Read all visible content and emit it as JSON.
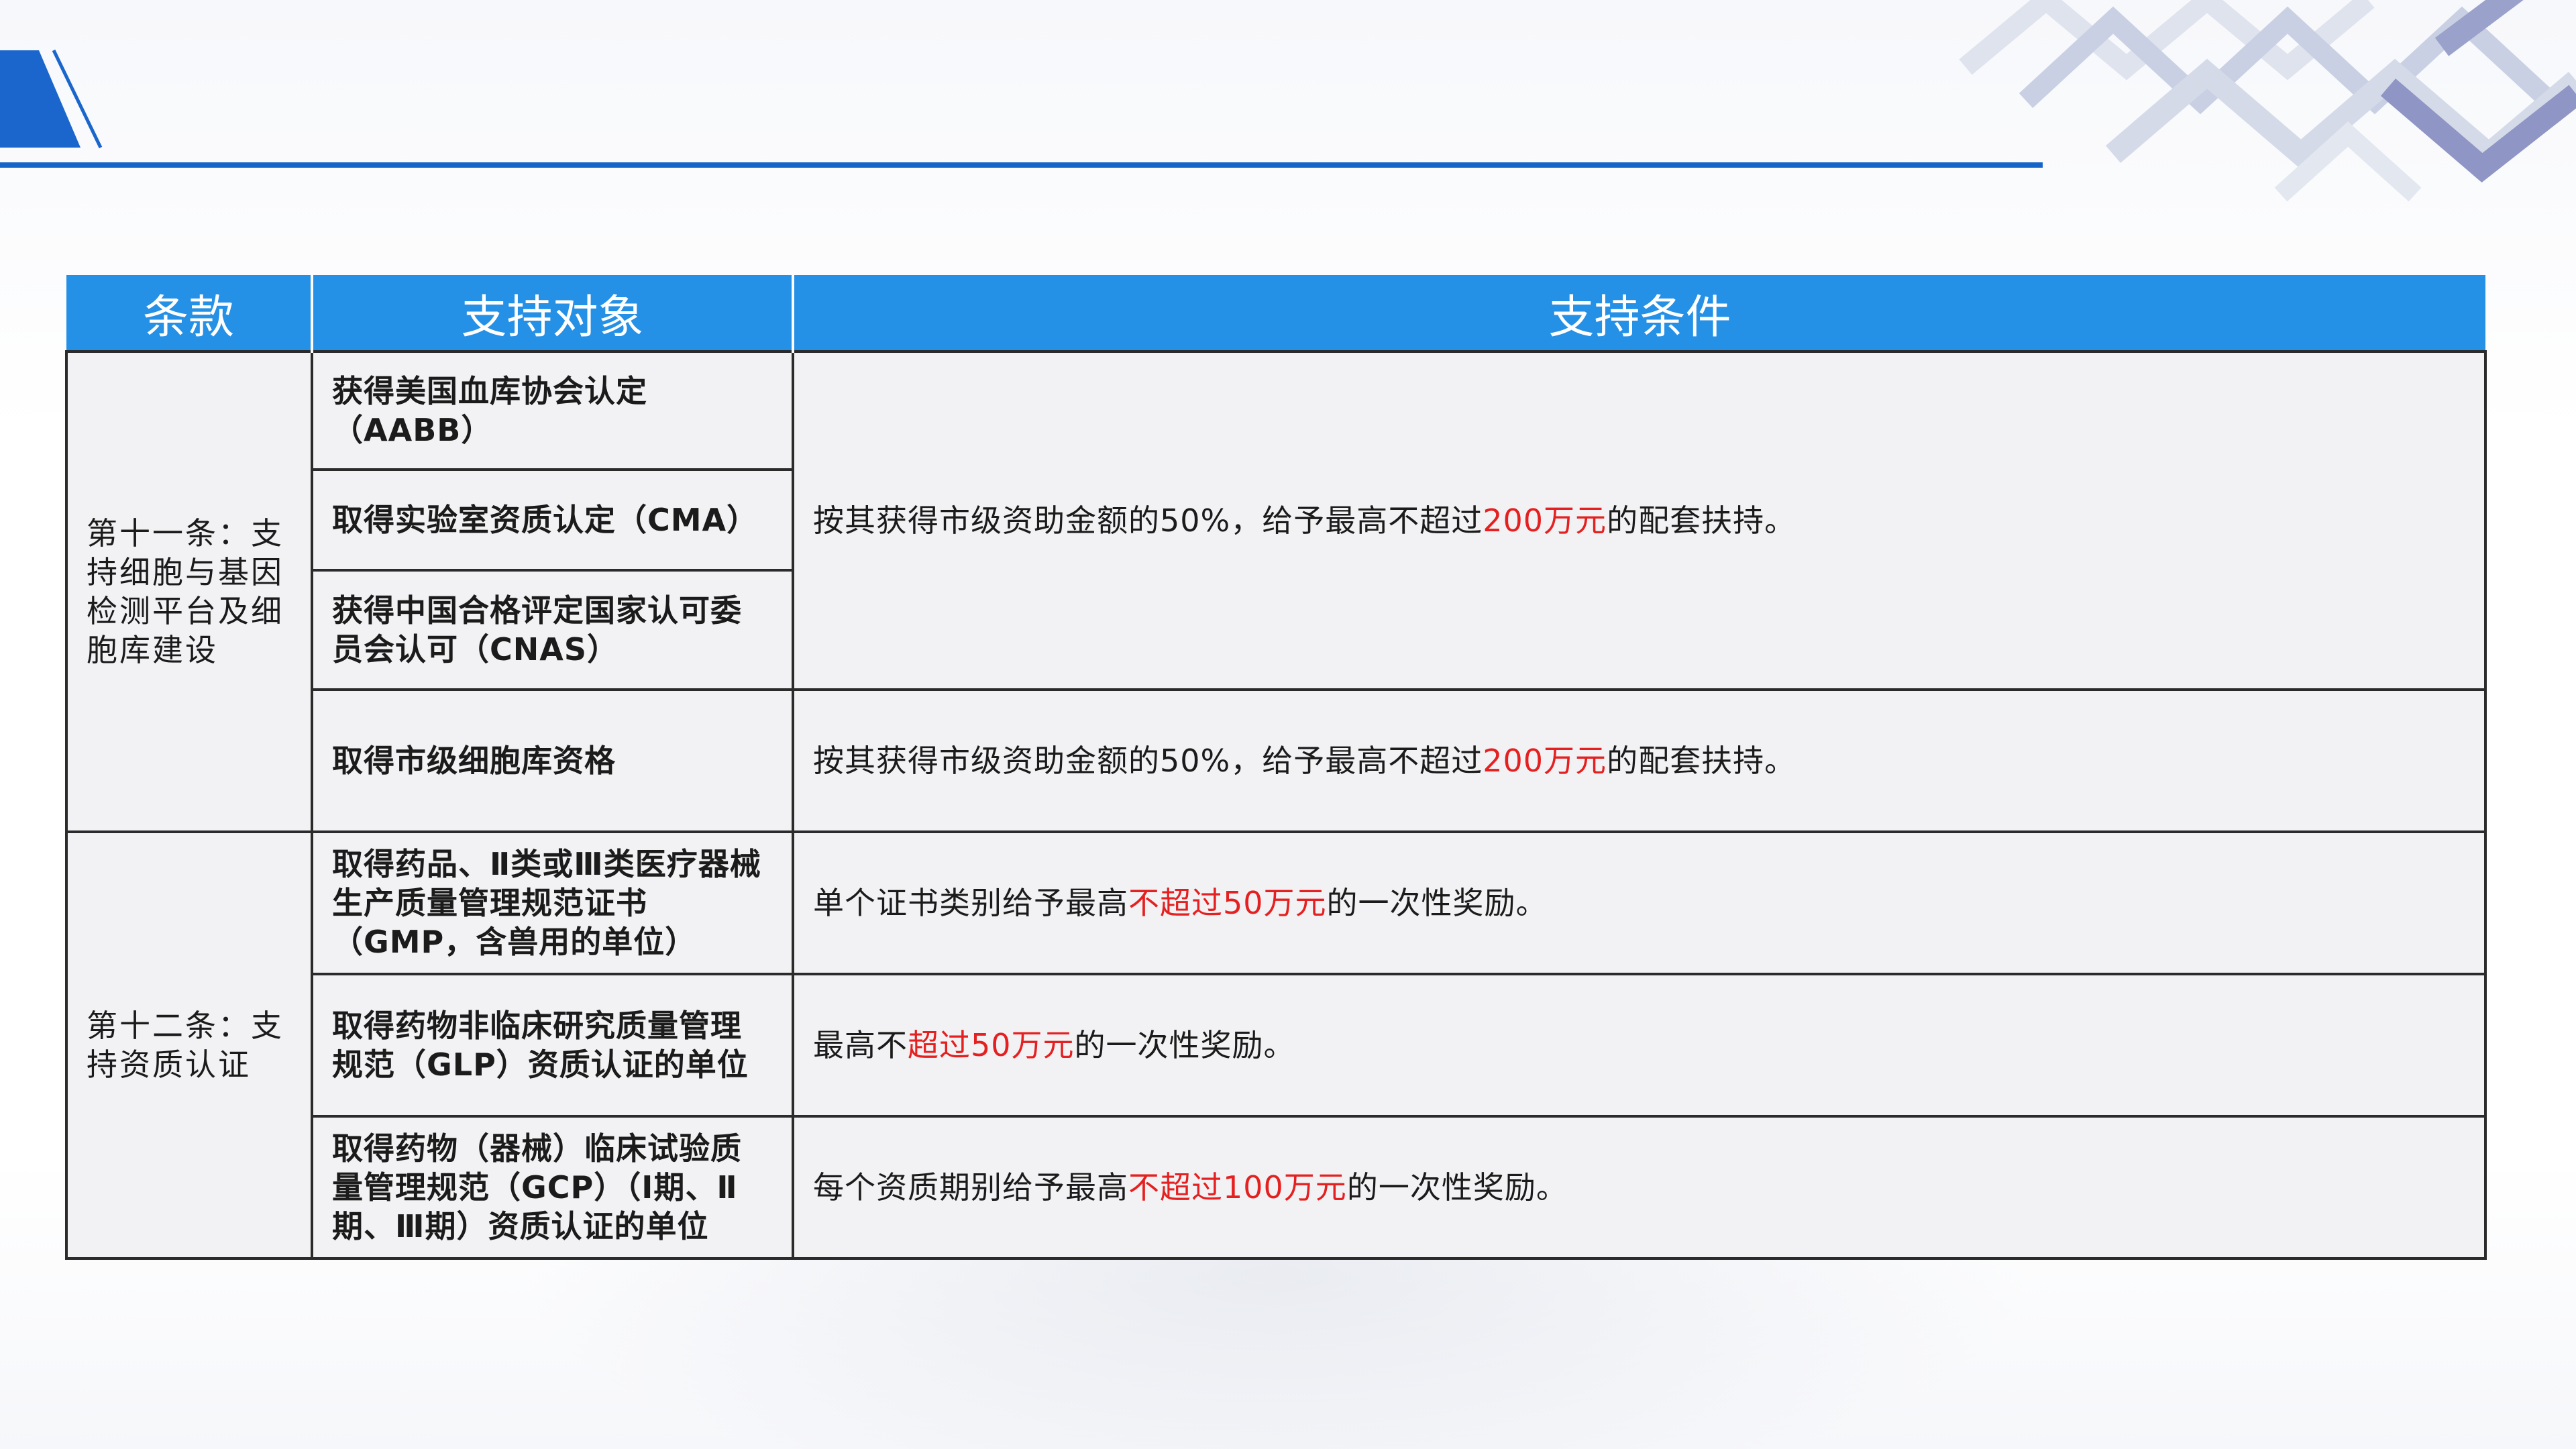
{
  "colors": {
    "accent": "#1565c8",
    "header_bg": "#2490e6",
    "target_text": "#2a78d0",
    "highlight": "#e52020",
    "cell_bg": "#f2f2f4"
  },
  "table": {
    "headers": [
      "条款",
      "支持对象",
      "支持条件"
    ],
    "clause_11": "第十一条：支持细胞与基因检测平台及细胞库建设",
    "clause_12": "第十二条：支持资质认证",
    "targets": [
      "获得美国血库协会认定（AABB）",
      "取得实验室资质认定（CMA）",
      "获得中国合格评定国家认可委员会认可（CNAS）",
      "取得市级细胞库资格",
      "取得药品、Ⅱ类或Ⅲ类医疗器械生产质量管理规范证书（GMP，含兽用的单位）",
      "取得药物非临床研究质量管理规范（GLP）资质认证的单位",
      "取得药物（器械）临床试验质量管理规范（GCP）（Ⅰ期、Ⅱ期、Ⅲ期）资质认证的单位"
    ],
    "conditions": [
      {
        "pre": "按其获得市级资助金额的50%，给予最高不超过",
        "red": "200万元",
        "post": "的配套扶持。"
      },
      {
        "pre": "按其获得市级资助金额的50%，给予最高不超过",
        "red": "200万元",
        "post": "的配套扶持。"
      },
      {
        "pre": "单个证书类别给予最高",
        "red": "不超过50万元",
        "post": "的一次性奖励。"
      },
      {
        "pre": "最高不",
        "red": "超过50万元",
        "post": "的一次性奖励。"
      },
      {
        "pre": "每个资质期别给予最高",
        "red": "不超过100万元",
        "post": "的一次性奖励。"
      }
    ]
  }
}
